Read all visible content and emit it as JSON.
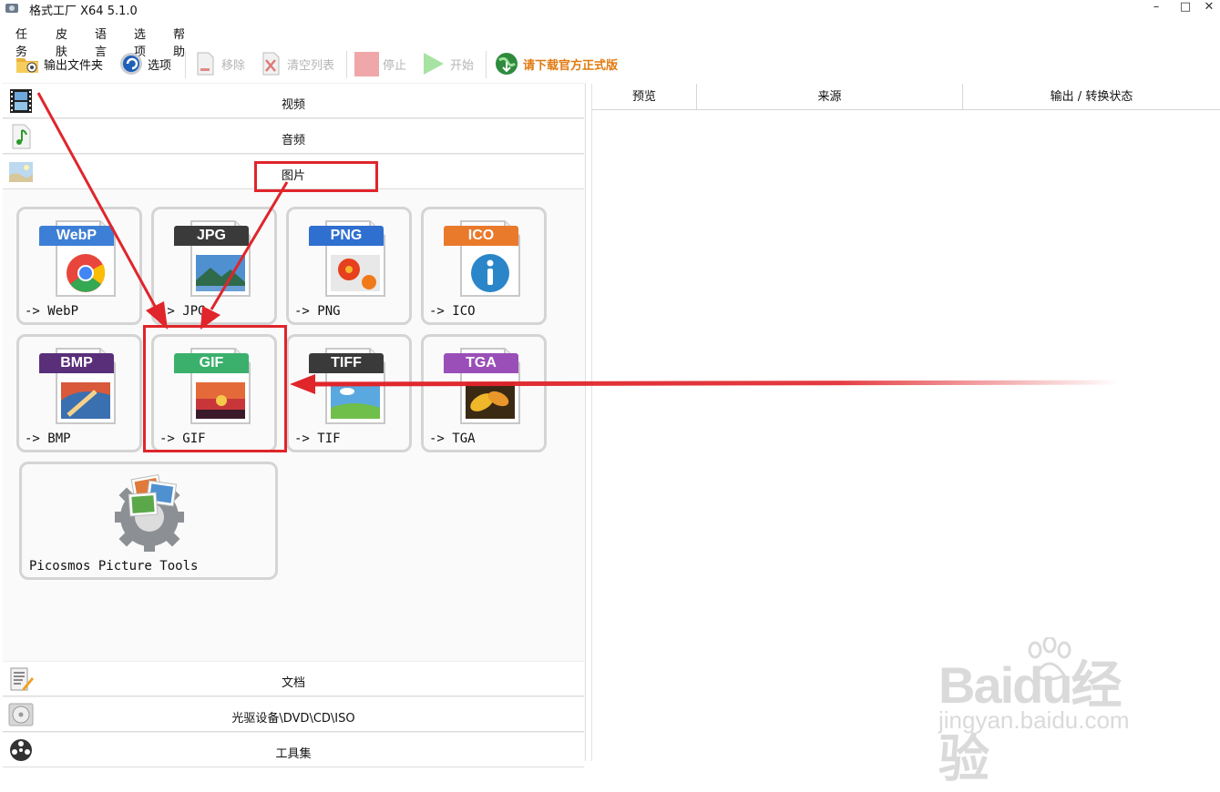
{
  "window": {
    "title": "格式工厂 X64 5.1.0",
    "minimize": "–",
    "maximize": "□",
    "close": "✕"
  },
  "menu": [
    "任务",
    "皮肤",
    "语言",
    "选项",
    "帮助"
  ],
  "toolbar": {
    "output_folder": "输出文件夹",
    "options": "选项",
    "remove": "移除",
    "clear_list": "清空列表",
    "stop": "停止",
    "start": "开始",
    "download": "请下载官方正式版"
  },
  "categories": {
    "video": "视频",
    "audio": "音频",
    "picture": "图片",
    "document": "文档",
    "disc": "光驱设备\\DVD\\CD\\ISO",
    "toolbox": "工具集"
  },
  "formats": [
    {
      "badge": "WebP",
      "label": "-> WebP",
      "color": "#3d7fd6"
    },
    {
      "badge": "JPG",
      "label": "-> JPG",
      "color": "#3a3a3a"
    },
    {
      "badge": "PNG",
      "label": "-> PNG",
      "color": "#2f6fd0"
    },
    {
      "badge": "ICO",
      "label": "-> ICO",
      "color": "#ea7a2b"
    },
    {
      "badge": "BMP",
      "label": "-> BMP",
      "color": "#5a2f7a"
    },
    {
      "badge": "GIF",
      "label": "-> GIF",
      "color": "#3bb06c"
    },
    {
      "badge": "TIFF",
      "label": "-> TIF",
      "color": "#3a3a3a"
    },
    {
      "badge": "TGA",
      "label": "-> TGA",
      "color": "#9a4fb8"
    }
  ],
  "tools": {
    "label": "Picosmos Picture Tools"
  },
  "task_columns": [
    "预览",
    "来源",
    "输出 / 转换状态"
  ],
  "watermark": {
    "brand": "Baidu经验",
    "url": "jingyan.baidu.com"
  },
  "annotation_color": "#e0252b"
}
